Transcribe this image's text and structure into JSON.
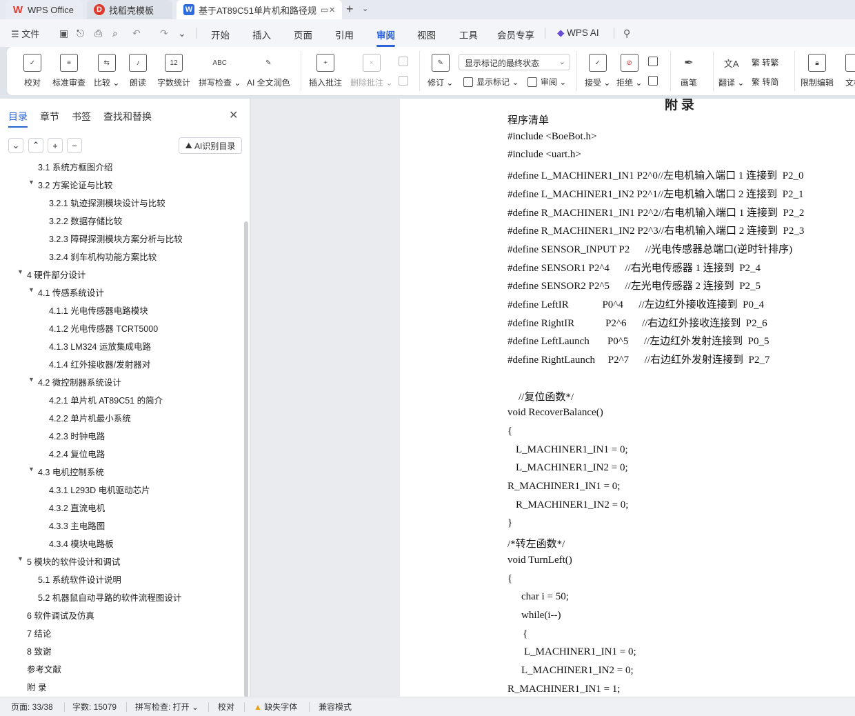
{
  "tabs": {
    "wps_label": "WPS Office",
    "template_label": "找稻壳模板",
    "doc_label": "基于AT89C51单片机和路径规"
  },
  "menu": {
    "file": "文件",
    "tabs": [
      "开始",
      "插入",
      "页面",
      "引用",
      "审阅",
      "视图",
      "工具",
      "会员专享",
      "WPS AI"
    ],
    "active": "审阅"
  },
  "ribbon": {
    "proofread": "校对",
    "standard_review": "标准审查",
    "compare": "比较",
    "read_aloud": "朗读",
    "word_count": "字数统计",
    "spell_check": "拼写检查",
    "ai_polish": "AI 全文润色",
    "insert_comment": "插入批注",
    "delete_comment": "删除批注",
    "revise": "修订",
    "markup_state": "显示标记的最终状态",
    "show_markup": "显示标记",
    "review": "审阅",
    "accept": "接受",
    "reject": "拒绝",
    "pen": "画笔",
    "translate": "翻译",
    "to_traditional": "转繁",
    "to_simplified": "转简",
    "restrict_edit": "限制编辑",
    "doc_more": "文档"
  },
  "panel": {
    "tabs": [
      "目录",
      "章节",
      "书签",
      "查找和替换"
    ],
    "ai_toc": "AI识别目录",
    "toc": [
      {
        "text": "3.1 系统方框图介绍",
        "level": 2,
        "arrow": false
      },
      {
        "text": "3.2 方案论证与比较",
        "level": 2,
        "arrow": true
      },
      {
        "text": "3.2.1 轨迹探测模块设计与比较",
        "level": 3,
        "arrow": false
      },
      {
        "text": "3.2.2 数据存储比较",
        "level": 3,
        "arrow": false
      },
      {
        "text": "3.2.3 障碍探测模块方案分析与比较",
        "level": 3,
        "arrow": false
      },
      {
        "text": "3.2.4 刹车机构功能方案比较",
        "level": 3,
        "arrow": false
      },
      {
        "text": "4 硬件部分设计",
        "level": 1,
        "arrow": true
      },
      {
        "text": "4.1 传感系统设计",
        "level": 2,
        "arrow": true
      },
      {
        "text": "4.1.1 光电传感器电路模块",
        "level": 3,
        "arrow": false
      },
      {
        "text": "4.1.2 光电传感器 TCRT5000",
        "level": 3,
        "arrow": false
      },
      {
        "text": "4.1.3 LM324 运放集成电路",
        "level": 3,
        "arrow": false
      },
      {
        "text": "4.1.4 红外接收器/发射器对",
        "level": 3,
        "arrow": false
      },
      {
        "text": "4.2 微控制器系统设计",
        "level": 2,
        "arrow": true
      },
      {
        "text": "4.2.1  单片机 AT89C51 的简介",
        "level": 3,
        "arrow": false
      },
      {
        "text": "4.2.2 单片机最小系统",
        "level": 3,
        "arrow": false
      },
      {
        "text": "4.2.3 时钟电路",
        "level": 3,
        "arrow": false
      },
      {
        "text": "4.2.4 复位电路",
        "level": 3,
        "arrow": false
      },
      {
        "text": "4.3 电机控制系统",
        "level": 2,
        "arrow": true
      },
      {
        "text": "4.3.1 L293D  电机驱动芯片",
        "level": 3,
        "arrow": false
      },
      {
        "text": "4.3.2 直流电机",
        "level": 3,
        "arrow": false
      },
      {
        "text": "4.3.3 主电路图",
        "level": 3,
        "arrow": false
      },
      {
        "text": "4.3.4 模块电路板",
        "level": 3,
        "arrow": false
      },
      {
        "text": "5  模块的软件设计和调试",
        "level": 1,
        "arrow": true
      },
      {
        "text": "5.1  系统软件设计说明",
        "level": 2,
        "arrow": false
      },
      {
        "text": "5.2  机器鼠自动寻路的软件流程图设计",
        "level": 2,
        "arrow": false
      },
      {
        "text": "6 软件调试及仿真",
        "level": 1,
        "arrow": false
      },
      {
        "text": "7 结论",
        "level": 1,
        "arrow": false
      },
      {
        "text": "8 致谢",
        "level": 1,
        "arrow": false
      },
      {
        "text": "参考文献",
        "level": 1,
        "arrow": false
      },
      {
        "text": "附  录",
        "level": 1,
        "arrow": false
      }
    ]
  },
  "document": {
    "title": "附  录",
    "lines": [
      {
        "text": "程序清单",
        "indent": 0
      },
      {
        "text": "#include <BoeBot.h>",
        "indent": 0
      },
      {
        "text": "#include <uart.h>",
        "indent": 0
      },
      {
        "text": "#define L_MACHINER1_IN1 P2^0//左电机输入端口 1 连接到  P2_0",
        "indent": 0
      },
      {
        "text": "#define L_MACHINER1_IN2 P2^1//左电机输入端口 2 连接到  P2_1",
        "indent": 0
      },
      {
        "text": "#define R_MACHINER1_IN1 P2^2//右电机输入端口 1 连接到  P2_2",
        "indent": 0
      },
      {
        "text": "#define R_MACHINER1_IN2 P2^3//右电机输入端口 2 连接到  P2_3",
        "indent": 0
      },
      {
        "text": "#define SENSOR_INPUT P2      //光电传感器总端口(逆时针排序)",
        "indent": 0
      },
      {
        "text": "#define SENSOR1 P2^4      //右光电传感器 1 连接到  P2_4",
        "indent": 0
      },
      {
        "text": "#define SENSOR2 P2^5      //左光电传感器 2 连接到  P2_5",
        "indent": 0
      },
      {
        "text": "#define LeftIR             P0^4      //左边红外接收连接到  P0_4",
        "indent": 0
      },
      {
        "text": "#define RightIR            P2^6      //右边红外接收连接到  P2_6",
        "indent": 0
      },
      {
        "text": "#define LeftLaunch       P0^5      //左边红外发射连接到  P0_5",
        "indent": 0
      },
      {
        "text": "#define RightLaunch     P2^7      //右边红外发射连接到  P2_7",
        "indent": 0
      },
      {
        "text": "",
        "indent": 0
      },
      {
        "text": "//复位函数*/",
        "indent": 16
      },
      {
        "text": "void RecoverBalance()",
        "indent": 0
      },
      {
        "text": "{",
        "indent": 0
      },
      {
        "text": "L_MACHINER1_IN1 = 0;",
        "indent": 12
      },
      {
        "text": "L_MACHINER1_IN2 = 0;",
        "indent": 12
      },
      {
        "text": "R_MACHINER1_IN1 = 0;",
        "indent": 0
      },
      {
        "text": "R_MACHINER1_IN2 = 0;",
        "indent": 12
      },
      {
        "text": "}",
        "indent": 0
      },
      {
        "text": "/*转左函数*/",
        "indent": 0
      },
      {
        "text": "void TurnLeft()",
        "indent": 0
      },
      {
        "text": "{",
        "indent": 0
      },
      {
        "text": "char i = 50;",
        "indent": 20
      },
      {
        "text": "while(i--)",
        "indent": 20
      },
      {
        "text": "{",
        "indent": 22
      },
      {
        "text": "L_MACHINER1_IN1 = 0;",
        "indent": 24
      },
      {
        "text": "L_MACHINER1_IN2 = 0;",
        "indent": 20
      },
      {
        "text": "R_MACHINER1_IN1 = 1;",
        "indent": 0
      }
    ]
  },
  "status": {
    "page": "页面: 33/38",
    "words": "字数: 15079",
    "spell": "拼写检查: 打开",
    "proof": "校对",
    "missing_font": "缺失字体",
    "compat": "兼容模式"
  }
}
